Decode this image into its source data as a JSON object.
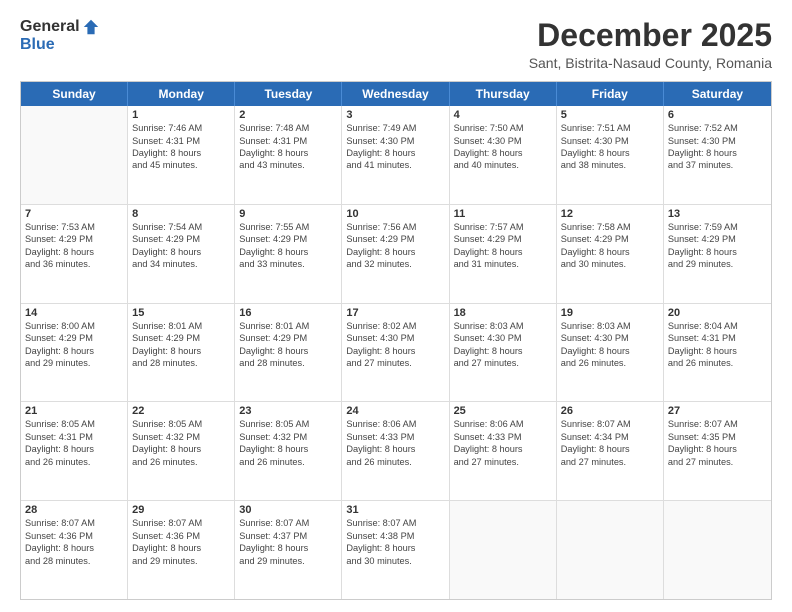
{
  "logo": {
    "general": "General",
    "blue": "Blue"
  },
  "title": "December 2025",
  "subtitle": "Sant, Bistrita-Nasaud County, Romania",
  "header_days": [
    "Sunday",
    "Monday",
    "Tuesday",
    "Wednesday",
    "Thursday",
    "Friday",
    "Saturday"
  ],
  "weeks": [
    [
      {
        "day": "",
        "lines": []
      },
      {
        "day": "1",
        "lines": [
          "Sunrise: 7:46 AM",
          "Sunset: 4:31 PM",
          "Daylight: 8 hours",
          "and 45 minutes."
        ]
      },
      {
        "day": "2",
        "lines": [
          "Sunrise: 7:48 AM",
          "Sunset: 4:31 PM",
          "Daylight: 8 hours",
          "and 43 minutes."
        ]
      },
      {
        "day": "3",
        "lines": [
          "Sunrise: 7:49 AM",
          "Sunset: 4:30 PM",
          "Daylight: 8 hours",
          "and 41 minutes."
        ]
      },
      {
        "day": "4",
        "lines": [
          "Sunrise: 7:50 AM",
          "Sunset: 4:30 PM",
          "Daylight: 8 hours",
          "and 40 minutes."
        ]
      },
      {
        "day": "5",
        "lines": [
          "Sunrise: 7:51 AM",
          "Sunset: 4:30 PM",
          "Daylight: 8 hours",
          "and 38 minutes."
        ]
      },
      {
        "day": "6",
        "lines": [
          "Sunrise: 7:52 AM",
          "Sunset: 4:30 PM",
          "Daylight: 8 hours",
          "and 37 minutes."
        ]
      }
    ],
    [
      {
        "day": "7",
        "lines": [
          "Sunrise: 7:53 AM",
          "Sunset: 4:29 PM",
          "Daylight: 8 hours",
          "and 36 minutes."
        ]
      },
      {
        "day": "8",
        "lines": [
          "Sunrise: 7:54 AM",
          "Sunset: 4:29 PM",
          "Daylight: 8 hours",
          "and 34 minutes."
        ]
      },
      {
        "day": "9",
        "lines": [
          "Sunrise: 7:55 AM",
          "Sunset: 4:29 PM",
          "Daylight: 8 hours",
          "and 33 minutes."
        ]
      },
      {
        "day": "10",
        "lines": [
          "Sunrise: 7:56 AM",
          "Sunset: 4:29 PM",
          "Daylight: 8 hours",
          "and 32 minutes."
        ]
      },
      {
        "day": "11",
        "lines": [
          "Sunrise: 7:57 AM",
          "Sunset: 4:29 PM",
          "Daylight: 8 hours",
          "and 31 minutes."
        ]
      },
      {
        "day": "12",
        "lines": [
          "Sunrise: 7:58 AM",
          "Sunset: 4:29 PM",
          "Daylight: 8 hours",
          "and 30 minutes."
        ]
      },
      {
        "day": "13",
        "lines": [
          "Sunrise: 7:59 AM",
          "Sunset: 4:29 PM",
          "Daylight: 8 hours",
          "and 29 minutes."
        ]
      }
    ],
    [
      {
        "day": "14",
        "lines": [
          "Sunrise: 8:00 AM",
          "Sunset: 4:29 PM",
          "Daylight: 8 hours",
          "and 29 minutes."
        ]
      },
      {
        "day": "15",
        "lines": [
          "Sunrise: 8:01 AM",
          "Sunset: 4:29 PM",
          "Daylight: 8 hours",
          "and 28 minutes."
        ]
      },
      {
        "day": "16",
        "lines": [
          "Sunrise: 8:01 AM",
          "Sunset: 4:29 PM",
          "Daylight: 8 hours",
          "and 28 minutes."
        ]
      },
      {
        "day": "17",
        "lines": [
          "Sunrise: 8:02 AM",
          "Sunset: 4:30 PM",
          "Daylight: 8 hours",
          "and 27 minutes."
        ]
      },
      {
        "day": "18",
        "lines": [
          "Sunrise: 8:03 AM",
          "Sunset: 4:30 PM",
          "Daylight: 8 hours",
          "and 27 minutes."
        ]
      },
      {
        "day": "19",
        "lines": [
          "Sunrise: 8:03 AM",
          "Sunset: 4:30 PM",
          "Daylight: 8 hours",
          "and 26 minutes."
        ]
      },
      {
        "day": "20",
        "lines": [
          "Sunrise: 8:04 AM",
          "Sunset: 4:31 PM",
          "Daylight: 8 hours",
          "and 26 minutes."
        ]
      }
    ],
    [
      {
        "day": "21",
        "lines": [
          "Sunrise: 8:05 AM",
          "Sunset: 4:31 PM",
          "Daylight: 8 hours",
          "and 26 minutes."
        ]
      },
      {
        "day": "22",
        "lines": [
          "Sunrise: 8:05 AM",
          "Sunset: 4:32 PM",
          "Daylight: 8 hours",
          "and 26 minutes."
        ]
      },
      {
        "day": "23",
        "lines": [
          "Sunrise: 8:05 AM",
          "Sunset: 4:32 PM",
          "Daylight: 8 hours",
          "and 26 minutes."
        ]
      },
      {
        "day": "24",
        "lines": [
          "Sunrise: 8:06 AM",
          "Sunset: 4:33 PM",
          "Daylight: 8 hours",
          "and 26 minutes."
        ]
      },
      {
        "day": "25",
        "lines": [
          "Sunrise: 8:06 AM",
          "Sunset: 4:33 PM",
          "Daylight: 8 hours",
          "and 27 minutes."
        ]
      },
      {
        "day": "26",
        "lines": [
          "Sunrise: 8:07 AM",
          "Sunset: 4:34 PM",
          "Daylight: 8 hours",
          "and 27 minutes."
        ]
      },
      {
        "day": "27",
        "lines": [
          "Sunrise: 8:07 AM",
          "Sunset: 4:35 PM",
          "Daylight: 8 hours",
          "and 27 minutes."
        ]
      }
    ],
    [
      {
        "day": "28",
        "lines": [
          "Sunrise: 8:07 AM",
          "Sunset: 4:36 PM",
          "Daylight: 8 hours",
          "and 28 minutes."
        ]
      },
      {
        "day": "29",
        "lines": [
          "Sunrise: 8:07 AM",
          "Sunset: 4:36 PM",
          "Daylight: 8 hours",
          "and 29 minutes."
        ]
      },
      {
        "day": "30",
        "lines": [
          "Sunrise: 8:07 AM",
          "Sunset: 4:37 PM",
          "Daylight: 8 hours",
          "and 29 minutes."
        ]
      },
      {
        "day": "31",
        "lines": [
          "Sunrise: 8:07 AM",
          "Sunset: 4:38 PM",
          "Daylight: 8 hours",
          "and 30 minutes."
        ]
      },
      {
        "day": "",
        "lines": []
      },
      {
        "day": "",
        "lines": []
      },
      {
        "day": "",
        "lines": []
      }
    ]
  ]
}
